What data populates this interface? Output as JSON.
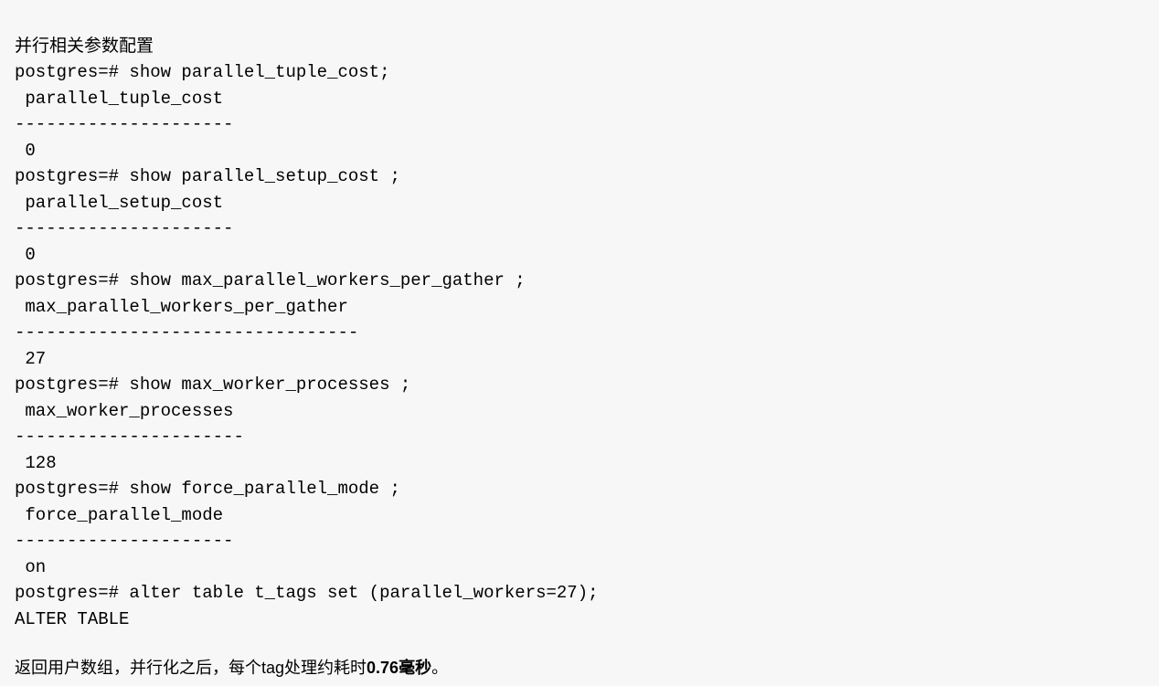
{
  "code": {
    "line1": "并行相关参数配置",
    "line2": "postgres=# show parallel_tuple_cost;",
    "line3": " parallel_tuple_cost",
    "line4": "---------------------",
    "line5": " 0",
    "line6": "postgres=# show parallel_setup_cost ;",
    "line7": " parallel_setup_cost",
    "line8": "---------------------",
    "line9": " 0",
    "line10": "postgres=# show max_parallel_workers_per_gather ;",
    "line11": " max_parallel_workers_per_gather",
    "line12": "---------------------------------",
    "line13": " 27",
    "line14": "postgres=# show max_worker_processes ;",
    "line15": " max_worker_processes",
    "line16": "----------------------",
    "line17": " 128",
    "line18": "postgres=# show force_parallel_mode ;",
    "line19": " force_parallel_mode",
    "line20": "---------------------",
    "line21": " on",
    "line22": "postgres=# alter table t_tags set (parallel_workers=27);",
    "line23": "ALTER TABLE"
  },
  "summary": {
    "prefix": "返回用户数组，并行化之后，每个tag处理约耗时",
    "bold": "0.76毫秒",
    "suffix": "。"
  }
}
